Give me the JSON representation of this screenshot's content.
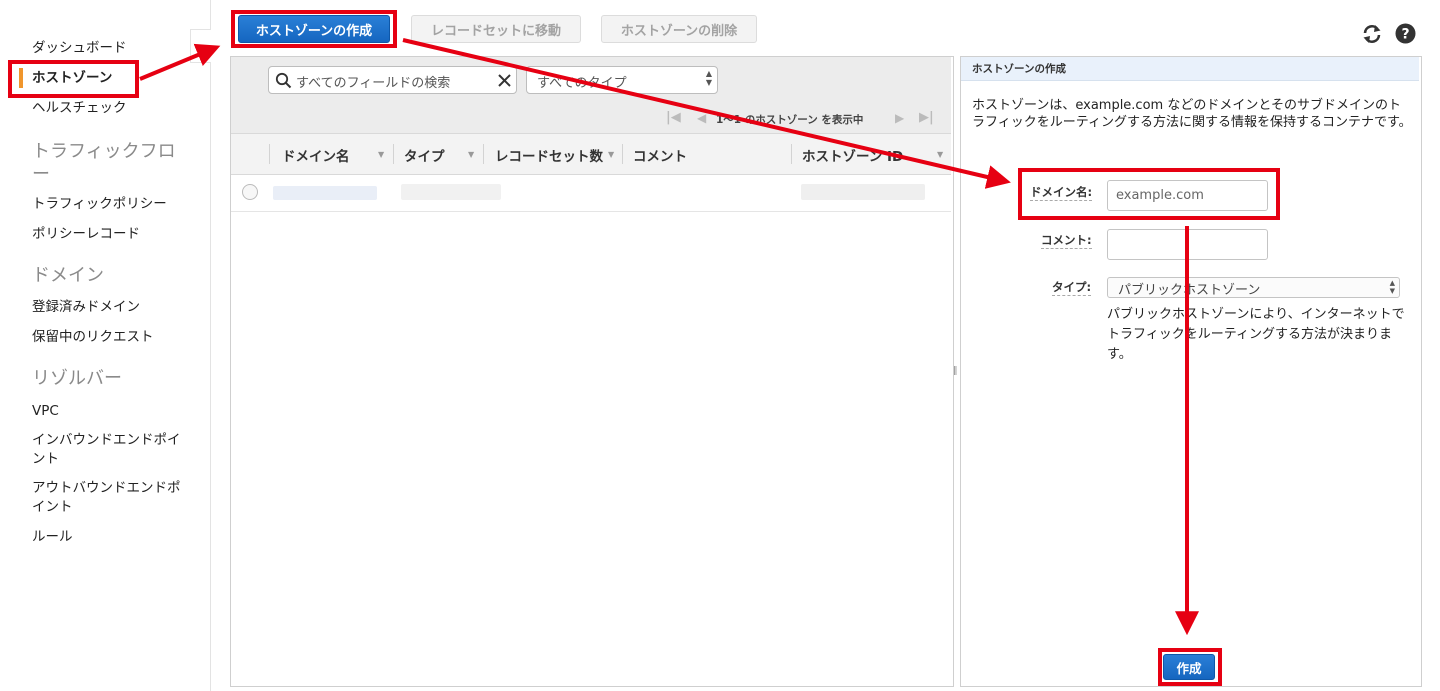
{
  "sidebar": {
    "dashboard": "ダッシュボード",
    "hosted_zones": "ホストゾーン",
    "health_checks": "ヘルスチェック",
    "traffic_flow_heading": "トラフィックフロー",
    "traffic_policies": "トラフィックポリシー",
    "policy_records": "ポリシーレコード",
    "domains_heading": "ドメイン",
    "registered_domains": "登録済みドメイン",
    "pending_requests": "保留中のリクエスト",
    "resolver_heading": "リゾルバー",
    "vpc": "VPC",
    "inbound_endpoints": "インバウンドエンドポイント",
    "outbound_endpoints": "アウトバウンドエンドポイント",
    "rules": "ルール"
  },
  "toolbar": {
    "create_zone": "ホストゾーンの作成",
    "goto_record_sets": "レコードセットに移動",
    "delete_zone": "ホストゾーンの削除"
  },
  "list": {
    "search_placeholder": "すべてのフィールドの検索",
    "type_filter": "すべてのタイプ",
    "pager": "1〜1 のホストゾーン を表示中",
    "columns": [
      "ドメイン名",
      "タイプ",
      "レコードセット数",
      "コメント",
      "ホストゾーン ID"
    ]
  },
  "create_panel": {
    "title": "ホストゾーンの作成",
    "description": "ホストゾーンは、example.com などのドメインとそのサブドメインのトラフィックをルーティングする方法に関する情報を保持するコンテナです。",
    "domain_label": "ドメイン名:",
    "domain_placeholder": "example.com",
    "comment_label": "コメント:",
    "type_label": "タイプ:",
    "type_value": "パブリックホストゾーン",
    "type_help": "パブリックホストゾーンにより、インターネットでトラフィックをルーティングする方法が決まります。",
    "create_button": "作成"
  },
  "colors": {
    "primary": "#1a6fca",
    "annotation_red": "#e60012",
    "active_marker": "#f0962c"
  }
}
